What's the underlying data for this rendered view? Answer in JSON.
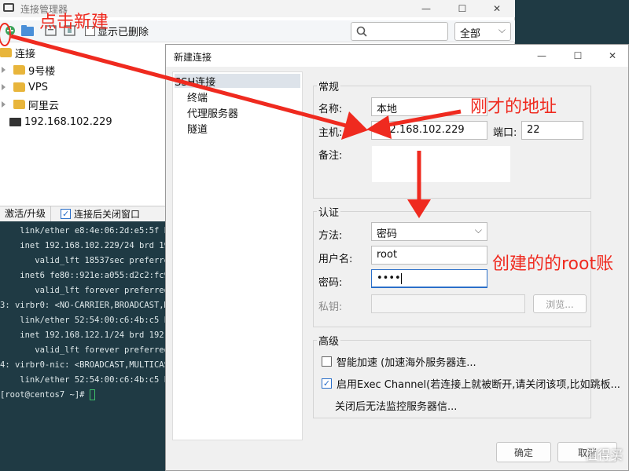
{
  "manager": {
    "title": "连接管理器",
    "delete_label": "显示已删除",
    "filter_value": "全部",
    "tree": {
      "root": "连接",
      "folders": [
        "9号楼",
        "VPS",
        "阿里云"
      ],
      "host": "192.168.102.229"
    },
    "bottom": {
      "activate_tab": "激活/升级",
      "close_after_connect": "连接后关闭窗口"
    }
  },
  "terminal": {
    "lines": [
      "    link/ether e8:4e:06:2d:e5:5f brd",
      "    inet 192.168.102.229/24 brd 192.",
      "       valid_lft 18537sec preferred_",
      "    inet6 fe80::921e:a055:d2c2:fc93/",
      "       valid_lft forever preferred_l",
      "3: virbr0: <NO-CARRIER,BROADCAST,MULT",
      "    link/ether 52:54:00:c6:4b:c5 brd",
      "    inet 192.168.122.1/24 brd 192.16",
      "       valid_lft forever preferred_l",
      "4: virbr0-nic: <BROADCAST,MULTICAST>",
      "    link/ether 52:54:00:c6:4b:c5 brd",
      "[root@centos7 ~]# "
    ]
  },
  "dialog": {
    "title": "新建连接",
    "nav": [
      "SSH连接",
      "终端",
      "代理服务器",
      "隧道"
    ],
    "general": {
      "legend": "常规",
      "name_label": "名称:",
      "name_value": "本地",
      "host_label": "主机:",
      "host_value": "192.168.102.229",
      "port_label": "端口:",
      "port_value": "22",
      "note_label": "备注:"
    },
    "auth": {
      "legend": "认证",
      "method_label": "方法:",
      "method_value": "密码",
      "user_label": "用户名:",
      "user_value": "root",
      "password_label": "密码:",
      "password_value": "••••",
      "key_label": "私钥:",
      "browse_label": "浏览..."
    },
    "advanced": {
      "legend": "高级",
      "accel_label": "智能加速 (加速海外服务器连...",
      "exec_label": "启用Exec Channel(若连接上就被断开,请关闭该项,比如跳板...",
      "exec_note": "关闭后无法监控服务器信..."
    },
    "ok_label": "确定",
    "cancel_label": "取消"
  },
  "annotations": {
    "click_new": "点击新建",
    "address": "刚才的地址",
    "root_account": "创建的的root账"
  },
  "watermark": "值得买",
  "colors": {
    "annotation": "#ef2a1f",
    "terminal_bg": "#1f3a44",
    "focus_blue": "#2a6fc9"
  }
}
